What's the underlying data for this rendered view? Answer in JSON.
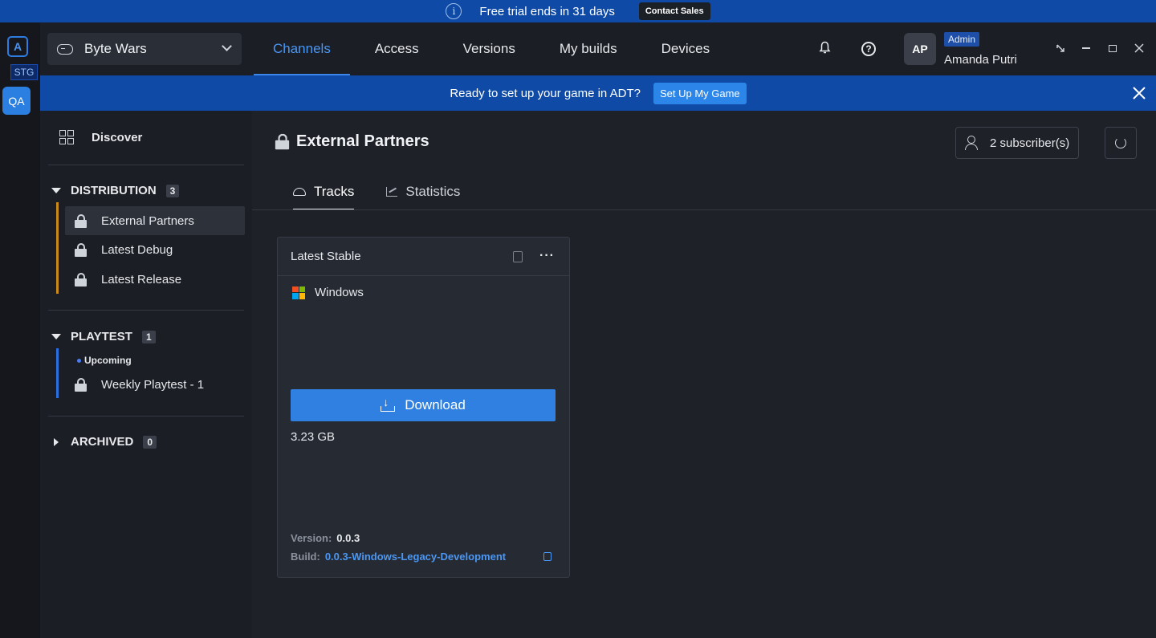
{
  "trial_banner": {
    "text": "Free trial ends in 31 days",
    "contact_label": "Contact Sales",
    "info_icon": "info-icon"
  },
  "rail": {
    "logo_text": "A",
    "env_badge": "STG",
    "workspace": "QA"
  },
  "game_selector": {
    "value": "Byte Wars"
  },
  "nav": {
    "tabs": [
      "Channels",
      "Access",
      "Versions",
      "My builds",
      "Devices"
    ],
    "active": "Channels"
  },
  "user": {
    "initials": "AP",
    "role": "Admin",
    "name": "Amanda Putri"
  },
  "setup_banner": {
    "text": "Ready to set up your game in ADT?",
    "button": "Set Up My Game"
  },
  "sidebar": {
    "discover": "Discover",
    "distribution": {
      "label": "DISTRIBUTION",
      "count": "3",
      "items": [
        "External Partners",
        "Latest Debug",
        "Latest Release"
      ]
    },
    "playtest": {
      "label": "PLAYTEST",
      "count": "1",
      "status": "Upcoming",
      "items": [
        "Weekly Playtest - 1"
      ]
    },
    "archived": {
      "label": "ARCHIVED",
      "count": "0"
    }
  },
  "channel": {
    "title": "External Partners",
    "subscribers": "2 subscriber(s)",
    "tabs": [
      "Tracks",
      "Statistics"
    ]
  },
  "track": {
    "name": "Latest Stable",
    "platform": "Windows",
    "download_label": "Download",
    "size": "3.23 GB",
    "version_label": "Version:",
    "version": "0.0.3",
    "build_label": "Build:",
    "build": "0.0.3-Windows-Legacy-Development"
  },
  "colors": {
    "accent": "#2f80e0",
    "banner": "#0e4aa6",
    "distribution_bar": "#c98a1b",
    "playtest_bar": "#2a6fe0"
  }
}
